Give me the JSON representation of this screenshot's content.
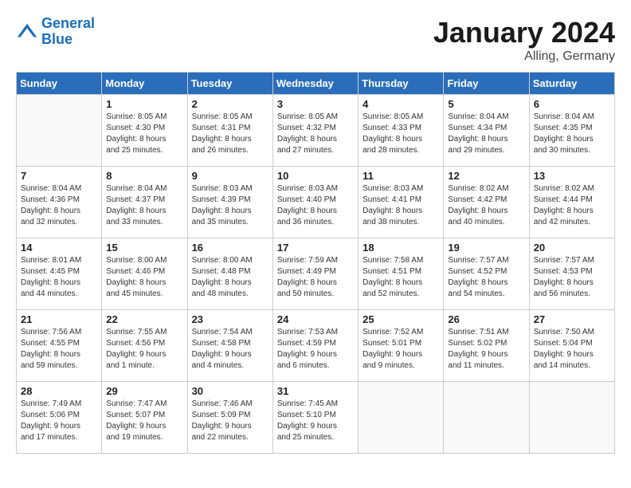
{
  "logo": {
    "line1": "General",
    "line2": "Blue"
  },
  "title": "January 2024",
  "location": "Alling, Germany",
  "days_header": [
    "Sunday",
    "Monday",
    "Tuesday",
    "Wednesday",
    "Thursday",
    "Friday",
    "Saturday"
  ],
  "weeks": [
    [
      {
        "day": "",
        "text": ""
      },
      {
        "day": "1",
        "text": "Sunrise: 8:05 AM\nSunset: 4:30 PM\nDaylight: 8 hours\nand 25 minutes."
      },
      {
        "day": "2",
        "text": "Sunrise: 8:05 AM\nSunset: 4:31 PM\nDaylight: 8 hours\nand 26 minutes."
      },
      {
        "day": "3",
        "text": "Sunrise: 8:05 AM\nSunset: 4:32 PM\nDaylight: 8 hours\nand 27 minutes."
      },
      {
        "day": "4",
        "text": "Sunrise: 8:05 AM\nSunset: 4:33 PM\nDaylight: 8 hours\nand 28 minutes."
      },
      {
        "day": "5",
        "text": "Sunrise: 8:04 AM\nSunset: 4:34 PM\nDaylight: 8 hours\nand 29 minutes."
      },
      {
        "day": "6",
        "text": "Sunrise: 8:04 AM\nSunset: 4:35 PM\nDaylight: 8 hours\nand 30 minutes."
      }
    ],
    [
      {
        "day": "7",
        "text": "Sunrise: 8:04 AM\nSunset: 4:36 PM\nDaylight: 8 hours\nand 32 minutes."
      },
      {
        "day": "8",
        "text": "Sunrise: 8:04 AM\nSunset: 4:37 PM\nDaylight: 8 hours\nand 33 minutes."
      },
      {
        "day": "9",
        "text": "Sunrise: 8:03 AM\nSunset: 4:39 PM\nDaylight: 8 hours\nand 35 minutes."
      },
      {
        "day": "10",
        "text": "Sunrise: 8:03 AM\nSunset: 4:40 PM\nDaylight: 8 hours\nand 36 minutes."
      },
      {
        "day": "11",
        "text": "Sunrise: 8:03 AM\nSunset: 4:41 PM\nDaylight: 8 hours\nand 38 minutes."
      },
      {
        "day": "12",
        "text": "Sunrise: 8:02 AM\nSunset: 4:42 PM\nDaylight: 8 hours\nand 40 minutes."
      },
      {
        "day": "13",
        "text": "Sunrise: 8:02 AM\nSunset: 4:44 PM\nDaylight: 8 hours\nand 42 minutes."
      }
    ],
    [
      {
        "day": "14",
        "text": "Sunrise: 8:01 AM\nSunset: 4:45 PM\nDaylight: 8 hours\nand 44 minutes."
      },
      {
        "day": "15",
        "text": "Sunrise: 8:00 AM\nSunset: 4:46 PM\nDaylight: 8 hours\nand 45 minutes."
      },
      {
        "day": "16",
        "text": "Sunrise: 8:00 AM\nSunset: 4:48 PM\nDaylight: 8 hours\nand 48 minutes."
      },
      {
        "day": "17",
        "text": "Sunrise: 7:59 AM\nSunset: 4:49 PM\nDaylight: 8 hours\nand 50 minutes."
      },
      {
        "day": "18",
        "text": "Sunrise: 7:58 AM\nSunset: 4:51 PM\nDaylight: 8 hours\nand 52 minutes."
      },
      {
        "day": "19",
        "text": "Sunrise: 7:57 AM\nSunset: 4:52 PM\nDaylight: 8 hours\nand 54 minutes."
      },
      {
        "day": "20",
        "text": "Sunrise: 7:57 AM\nSunset: 4:53 PM\nDaylight: 8 hours\nand 56 minutes."
      }
    ],
    [
      {
        "day": "21",
        "text": "Sunrise: 7:56 AM\nSunset: 4:55 PM\nDaylight: 8 hours\nand 59 minutes."
      },
      {
        "day": "22",
        "text": "Sunrise: 7:55 AM\nSunset: 4:56 PM\nDaylight: 9 hours\nand 1 minute."
      },
      {
        "day": "23",
        "text": "Sunrise: 7:54 AM\nSunset: 4:58 PM\nDaylight: 9 hours\nand 4 minutes."
      },
      {
        "day": "24",
        "text": "Sunrise: 7:53 AM\nSunset: 4:59 PM\nDaylight: 9 hours\nand 6 minutes."
      },
      {
        "day": "25",
        "text": "Sunrise: 7:52 AM\nSunset: 5:01 PM\nDaylight: 9 hours\nand 9 minutes."
      },
      {
        "day": "26",
        "text": "Sunrise: 7:51 AM\nSunset: 5:02 PM\nDaylight: 9 hours\nand 11 minutes."
      },
      {
        "day": "27",
        "text": "Sunrise: 7:50 AM\nSunset: 5:04 PM\nDaylight: 9 hours\nand 14 minutes."
      }
    ],
    [
      {
        "day": "28",
        "text": "Sunrise: 7:49 AM\nSunset: 5:06 PM\nDaylight: 9 hours\nand 17 minutes."
      },
      {
        "day": "29",
        "text": "Sunrise: 7:47 AM\nSunset: 5:07 PM\nDaylight: 9 hours\nand 19 minutes."
      },
      {
        "day": "30",
        "text": "Sunrise: 7:46 AM\nSunset: 5:09 PM\nDaylight: 9 hours\nand 22 minutes."
      },
      {
        "day": "31",
        "text": "Sunrise: 7:45 AM\nSunset: 5:10 PM\nDaylight: 9 hours\nand 25 minutes."
      },
      {
        "day": "",
        "text": ""
      },
      {
        "day": "",
        "text": ""
      },
      {
        "day": "",
        "text": ""
      }
    ]
  ]
}
